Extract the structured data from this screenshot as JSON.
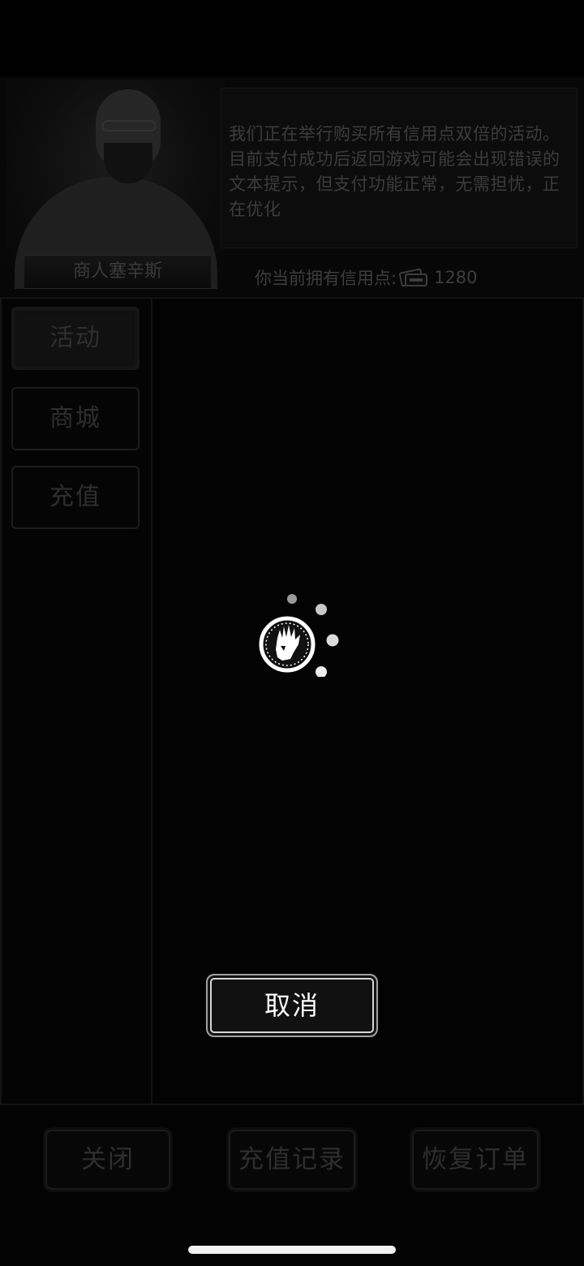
{
  "merchant": {
    "name": "商人塞辛斯",
    "notice": "我们正在举行购买所有信用点双倍的活动。目前支付成功后返回游戏可能会出现错误的文本提示，但支付功能正常，无需担忧，正在优化",
    "credits_label": "你当前拥有信用点:",
    "credits_icon": "ticket-icon",
    "credits_value": "1280"
  },
  "sidebar": {
    "items": [
      {
        "label": "活动"
      },
      {
        "label": "商城"
      },
      {
        "label": "充值"
      }
    ]
  },
  "loading": {
    "icon": "zombie-hand-spinner-icon",
    "cancel_label": "取消"
  },
  "bottom_bar": {
    "close_label": "关闭",
    "history_label": "充值记录",
    "restore_label": "恢复订单"
  },
  "colors": {
    "background": "#000000",
    "dimmed_text": "#3c3c3c",
    "active_text": "#ffffff"
  }
}
